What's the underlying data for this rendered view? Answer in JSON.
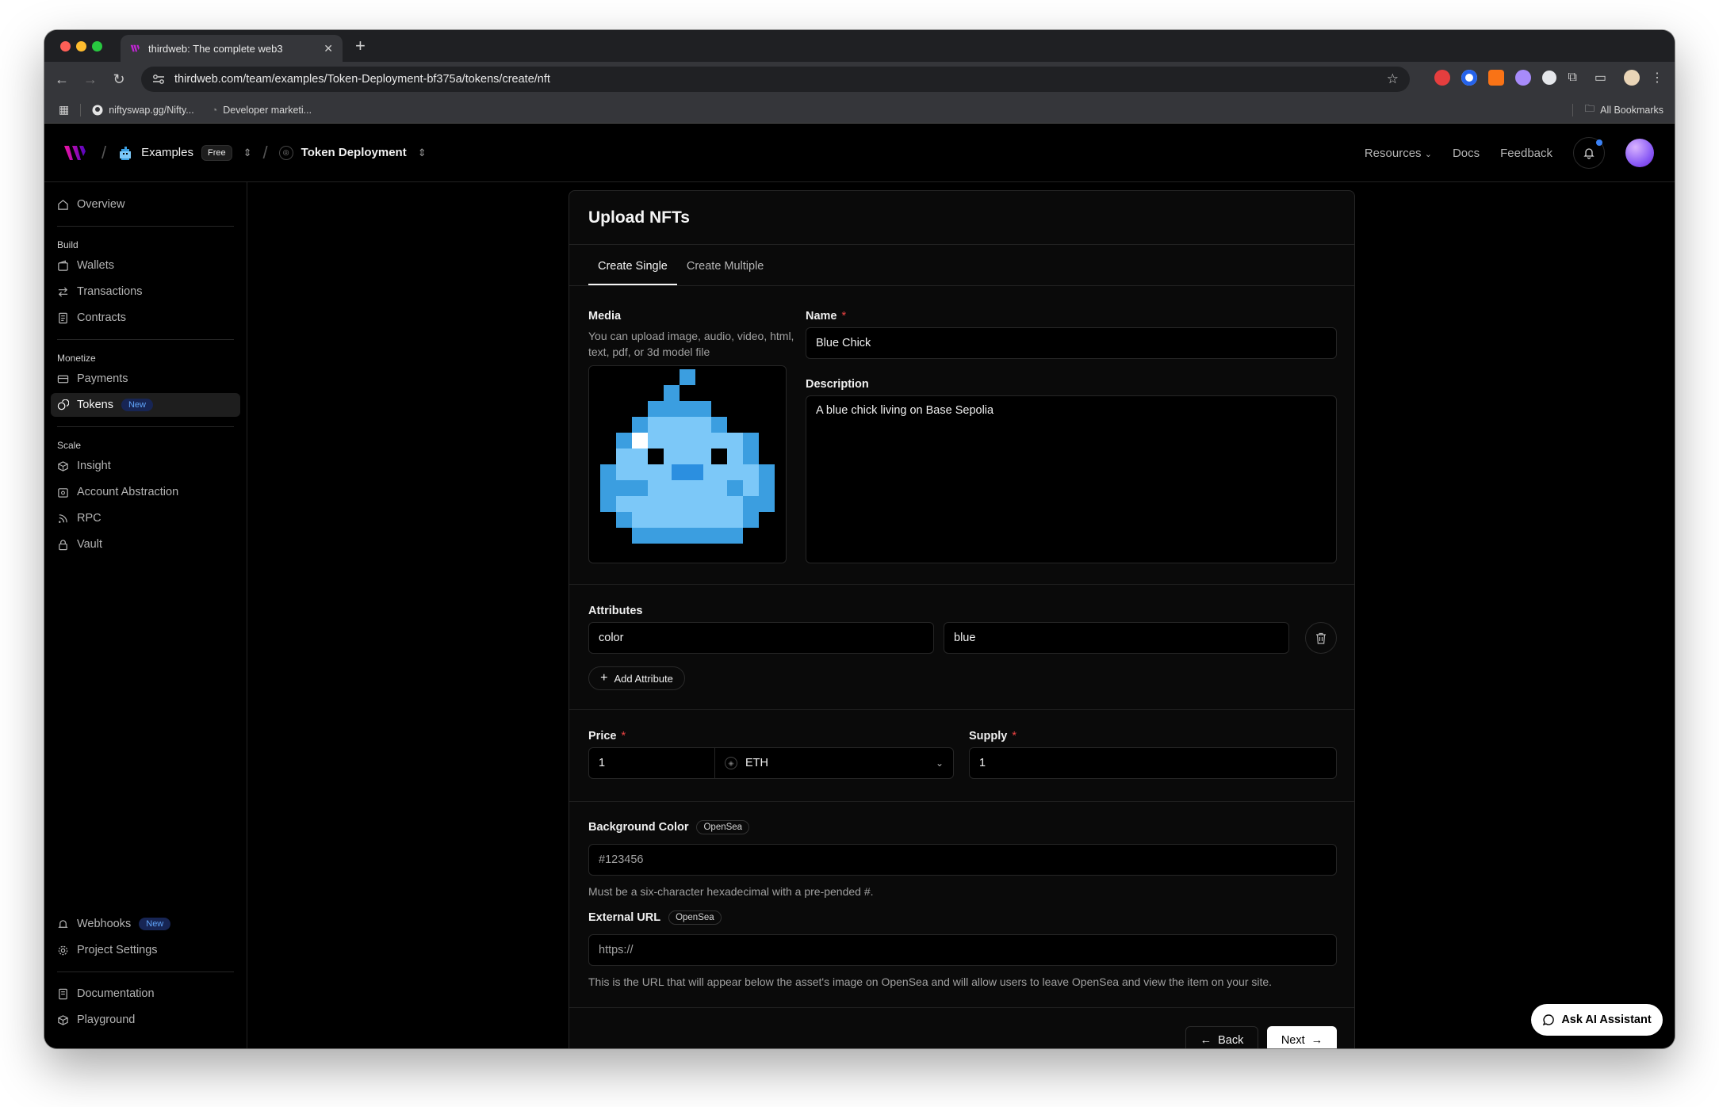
{
  "browser": {
    "tab_title": "thirdweb: The complete web3",
    "url": "thirdweb.com/team/examples/Token-Deployment-bf375a/tokens/create/nft",
    "bookmarks": [
      "niftyswap.gg/Nifty...",
      "Developer marketi..."
    ],
    "all_bookmarks": "All Bookmarks"
  },
  "header": {
    "team": "Examples",
    "plan": "Free",
    "project": "Token Deployment",
    "resources": "Resources",
    "docs": "Docs",
    "feedback": "Feedback"
  },
  "sidebar": {
    "overview": "Overview",
    "sections": {
      "build": "Build",
      "monetize": "Monetize",
      "scale": "Scale"
    },
    "build_items": [
      "Wallets",
      "Transactions",
      "Contracts"
    ],
    "monetize_items": [
      "Payments",
      "Tokens"
    ],
    "tokens_badge": "New",
    "scale_items": [
      "Insight",
      "Account Abstraction",
      "RPC",
      "Vault"
    ],
    "webhooks": "Webhooks",
    "webhooks_badge": "New",
    "project_settings": "Project Settings",
    "documentation": "Documentation",
    "playground": "Playground"
  },
  "form": {
    "title": "Upload NFTs",
    "tabs": [
      "Create Single",
      "Create Multiple"
    ],
    "media_label": "Media",
    "media_hint": "You can upload image, audio, video, html, text, pdf, or 3d model file",
    "name_label": "Name",
    "name_value": "Blue Chick",
    "description_label": "Description",
    "description_value": "A blue chick living on Base Sepolia",
    "attributes_label": "Attributes",
    "attribute_key": "color",
    "attribute_value": "blue",
    "add_attribute": "Add Attribute",
    "price_label": "Price",
    "price_value": "1",
    "currency": "ETH",
    "supply_label": "Supply",
    "supply_value": "1",
    "bg_color_label": "Background Color",
    "opensea_tag": "OpenSea",
    "bg_color_placeholder": "#123456",
    "bg_color_hint": "Must be a six-character hexadecimal with a pre-pended #.",
    "external_url_label": "External URL",
    "external_url_placeholder": "https://",
    "external_url_hint": "This is the URL that will appear below the asset's image on OpenSea and will allow users to leave OpenSea and view the item on your site.",
    "back": "Back",
    "next": "Next"
  },
  "assistant": "Ask AI Assistant",
  "colors": {
    "accent_blue": "#3b82f6",
    "required_red": "#ef4444",
    "chick_light": "#7cc8f8",
    "chick_mid": "#3b9ee0",
    "chick_dark": "#2b7dc4"
  }
}
